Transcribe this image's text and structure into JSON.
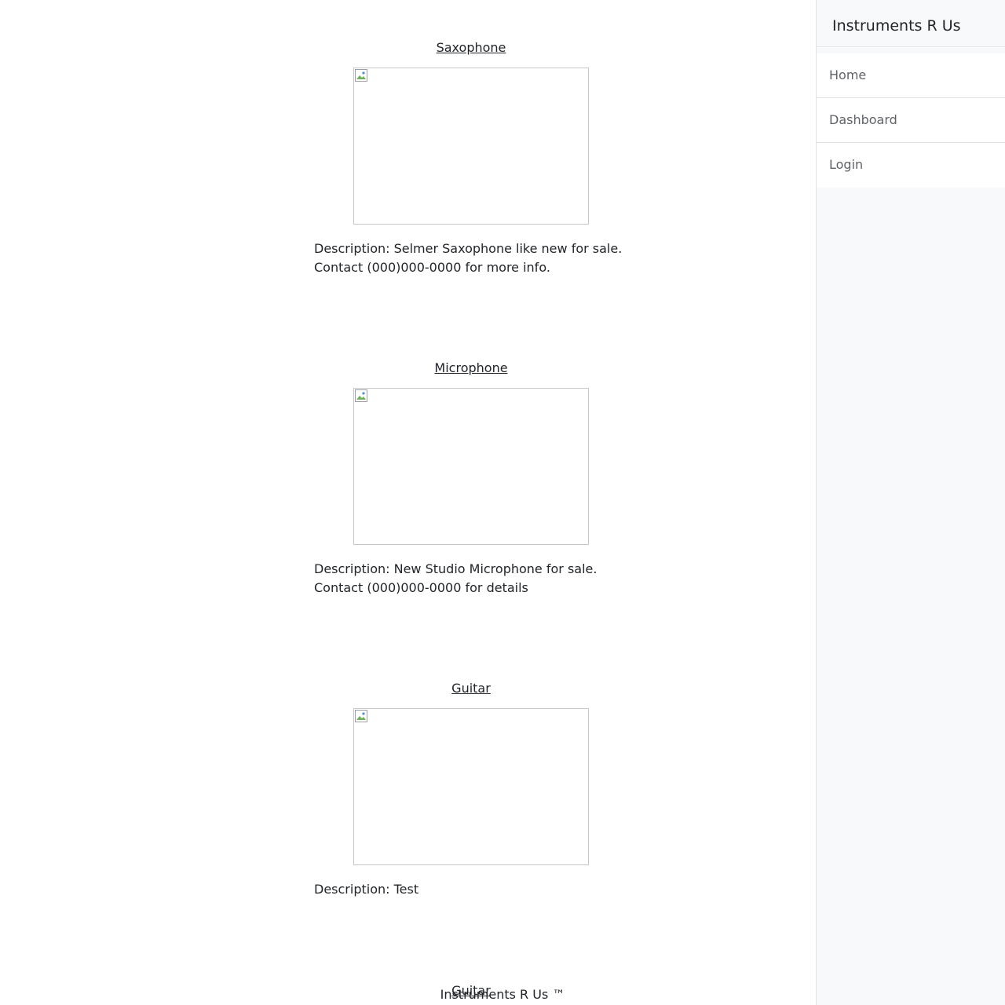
{
  "sidebar": {
    "brand": "Instruments R Us",
    "items": [
      {
        "label": "Home"
      },
      {
        "label": "Dashboard"
      },
      {
        "label": "Login"
      }
    ]
  },
  "listings": [
    {
      "title": "Saxophone",
      "description_lines": [
        "Description: Selmer Saxophone like new for sale.",
        "Contact (000)000-0000 for more info."
      ]
    },
    {
      "title": "Microphone",
      "description_lines": [
        "Description: New Studio Microphone for sale.",
        "Contact (000)000-0000 for details"
      ]
    },
    {
      "title": "Guitar",
      "description_lines": [
        "Description: Test"
      ]
    },
    {
      "title": "Guitar",
      "description_lines": []
    }
  ],
  "footer": {
    "text": "Instruments R Us ™"
  },
  "icons": {
    "listing_image": "broken-image-icon"
  }
}
